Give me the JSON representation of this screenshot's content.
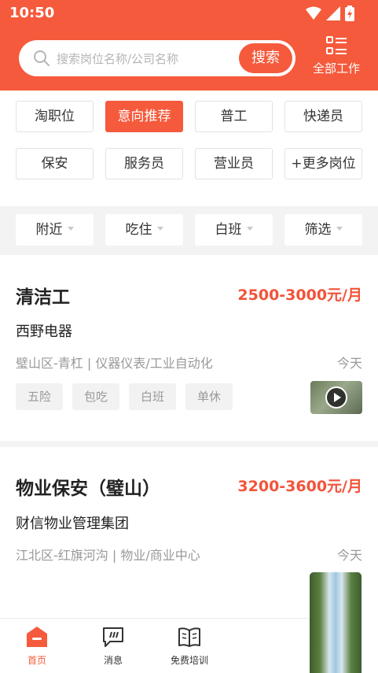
{
  "status_bar": {
    "time": "10:50"
  },
  "search": {
    "placeholder": "搜索岗位名称/公司名称",
    "button_label": "搜索"
  },
  "all_jobs": {
    "label": "全部工作"
  },
  "category_tags": [
    {
      "label": "淘职位",
      "active": false
    },
    {
      "label": "意向推荐",
      "active": true
    },
    {
      "label": "普工",
      "active": false
    },
    {
      "label": "快递员",
      "active": false
    },
    {
      "label": "保安",
      "active": false
    },
    {
      "label": "服务员",
      "active": false
    },
    {
      "label": "营业员",
      "active": false
    },
    {
      "label": "+更多岗位",
      "active": false
    }
  ],
  "filters": [
    {
      "label": "附近"
    },
    {
      "label": "吃住"
    },
    {
      "label": "白班"
    },
    {
      "label": "筛选"
    }
  ],
  "jobs": [
    {
      "title": "清洁工",
      "salary": "2500-3000元/月",
      "company": "西野电器",
      "location": "璧山区-青杠 | 仪器仪表/工业自动化",
      "date": "今天",
      "benefits": [
        "五险",
        "包吃",
        "白班",
        "单休"
      ]
    },
    {
      "title": "物业保安（璧山）",
      "salary": "3200-3600元/月",
      "company": "财信物业管理集团",
      "location": "江北区-红旗河沟 | 物业/商业中心",
      "date": "今天"
    }
  ],
  "tab_bar": {
    "items": [
      {
        "label": "首页",
        "icon": "home-icon",
        "active": true
      },
      {
        "label": "消息",
        "icon": "message-icon",
        "active": false
      },
      {
        "label": "免费培训",
        "icon": "book-icon",
        "active": false
      }
    ]
  },
  "colors": {
    "accent": "#f55a3c",
    "salary": "#f2533a"
  }
}
